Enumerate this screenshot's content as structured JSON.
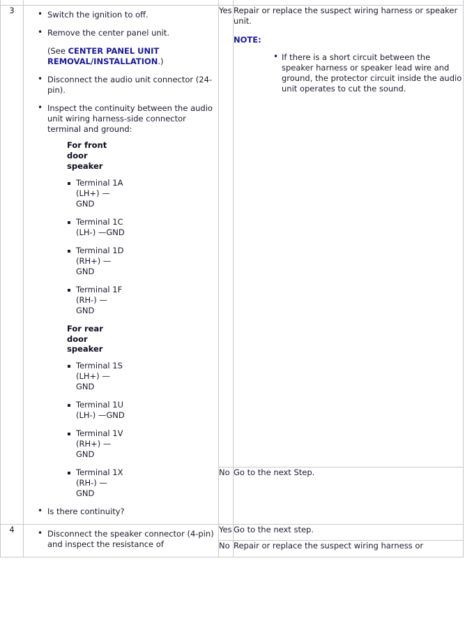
{
  "document": {
    "type": "troubleshooting-table",
    "link_color": "#1b1b8f",
    "text_color": "#1a1a2e",
    "border_color": "#c8c8c8"
  },
  "steps": [
    {
      "number": "3",
      "inspection": {
        "items": [
          {
            "kind": "bullet",
            "text": "Switch the ignition to off."
          },
          {
            "kind": "bullet",
            "text": "Remove the center panel unit."
          },
          {
            "kind": "reference",
            "prefix": "(See ",
            "link": "CENTER PANEL UNIT REMOVAL/INSTALLATION",
            "suffix": ".)"
          },
          {
            "kind": "bullet",
            "text": "Disconnect the audio unit connector (24-pin)."
          },
          {
            "kind": "bullet",
            "text": "Inspect the continuity between the audio unit wiring harness-side connector terminal and ground:"
          }
        ],
        "groups": [
          {
            "heading": "For front door speaker",
            "terminals": [
              "Terminal 1A (LH+) —GND",
              "Terminal 1C (LH-) —GND",
              "Terminal 1D (RH+) —GND",
              "Terminal 1F (RH-) —GND"
            ]
          },
          {
            "heading": "For rear door speaker",
            "terminals": [
              "Terminal 1S (LH+) —GND",
              "Terminal 1U (LH-) —GND",
              "Terminal 1V (RH+) —GND",
              "Terminal 1X (RH-) —GND"
            ]
          }
        ],
        "question": "Is there continuity?"
      },
      "results": [
        {
          "answer": "Yes",
          "action": "Repair or replace the suspect wiring harness or speaker unit.",
          "note_label": "NOTE:",
          "note_items": [
            "If there is a short circuit between the speaker harness or speaker lead wire and ground, the protector circuit inside the audio unit operates to cut the sound."
          ]
        },
        {
          "answer": "No",
          "action": "Go to the next Step."
        }
      ]
    },
    {
      "number": "4",
      "inspection": {
        "items": [
          {
            "kind": "bullet",
            "text": "Disconnect the speaker connector (4-pin) and inspect the resistance of"
          }
        ]
      },
      "results": [
        {
          "answer": "Yes",
          "action": "Go to the next step."
        },
        {
          "answer": "No",
          "action": "Repair or replace the suspect wiring harness or"
        }
      ]
    }
  ]
}
